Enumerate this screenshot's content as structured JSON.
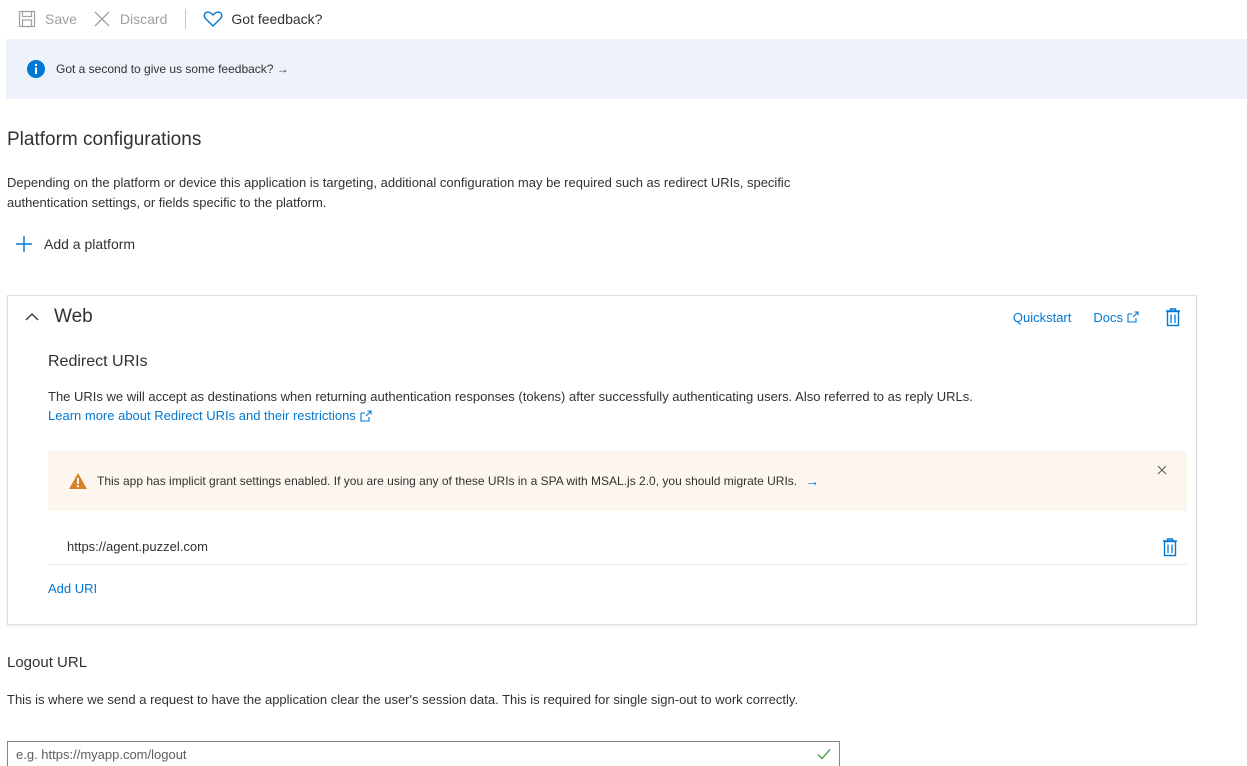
{
  "toolbar": {
    "save_label": "Save",
    "discard_label": "Discard",
    "feedback_label": "Got feedback?"
  },
  "info_banner": {
    "text": "Got a second to give us some feedback? →",
    "icon": "info-icon"
  },
  "platform": {
    "title": "Platform configurations",
    "description": "Depending on the platform or device this application is targeting, additional configuration may be required such as redirect URIs, specific authentication settings, or fields specific to the platform.",
    "add_platform_label": "Add a platform"
  },
  "web_card": {
    "title": "Web",
    "quickstart_label": "Quickstart",
    "docs_label": "Docs",
    "redirect_title": "Redirect URIs",
    "redirect_description": "The URIs we will accept as destinations when returning authentication responses (tokens) after successfully authenticating users. Also referred to as reply URLs.",
    "learn_more_label": "Learn more about Redirect URIs and their restrictions",
    "warning_text": "This app has implicit grant settings enabled. If you are using any of these URIs in a SPA with MSAL.js 2.0, you should migrate URIs.",
    "warning_arrow": "→",
    "uris": [
      "https://agent.puzzel.com"
    ],
    "add_uri_label": "Add URI"
  },
  "logout": {
    "title": "Logout URL",
    "description": "This is where we send a request to have the application clear the user's session data. This is required for single sign-out to work correctly.",
    "placeholder": "e.g. https://myapp.com/logout"
  },
  "colors": {
    "accent": "#0078d4",
    "info_bg": "#eef3fb",
    "warning_bg": "#fdf6ef",
    "warning_icon": "#d8812c",
    "success": "#5aa454"
  }
}
